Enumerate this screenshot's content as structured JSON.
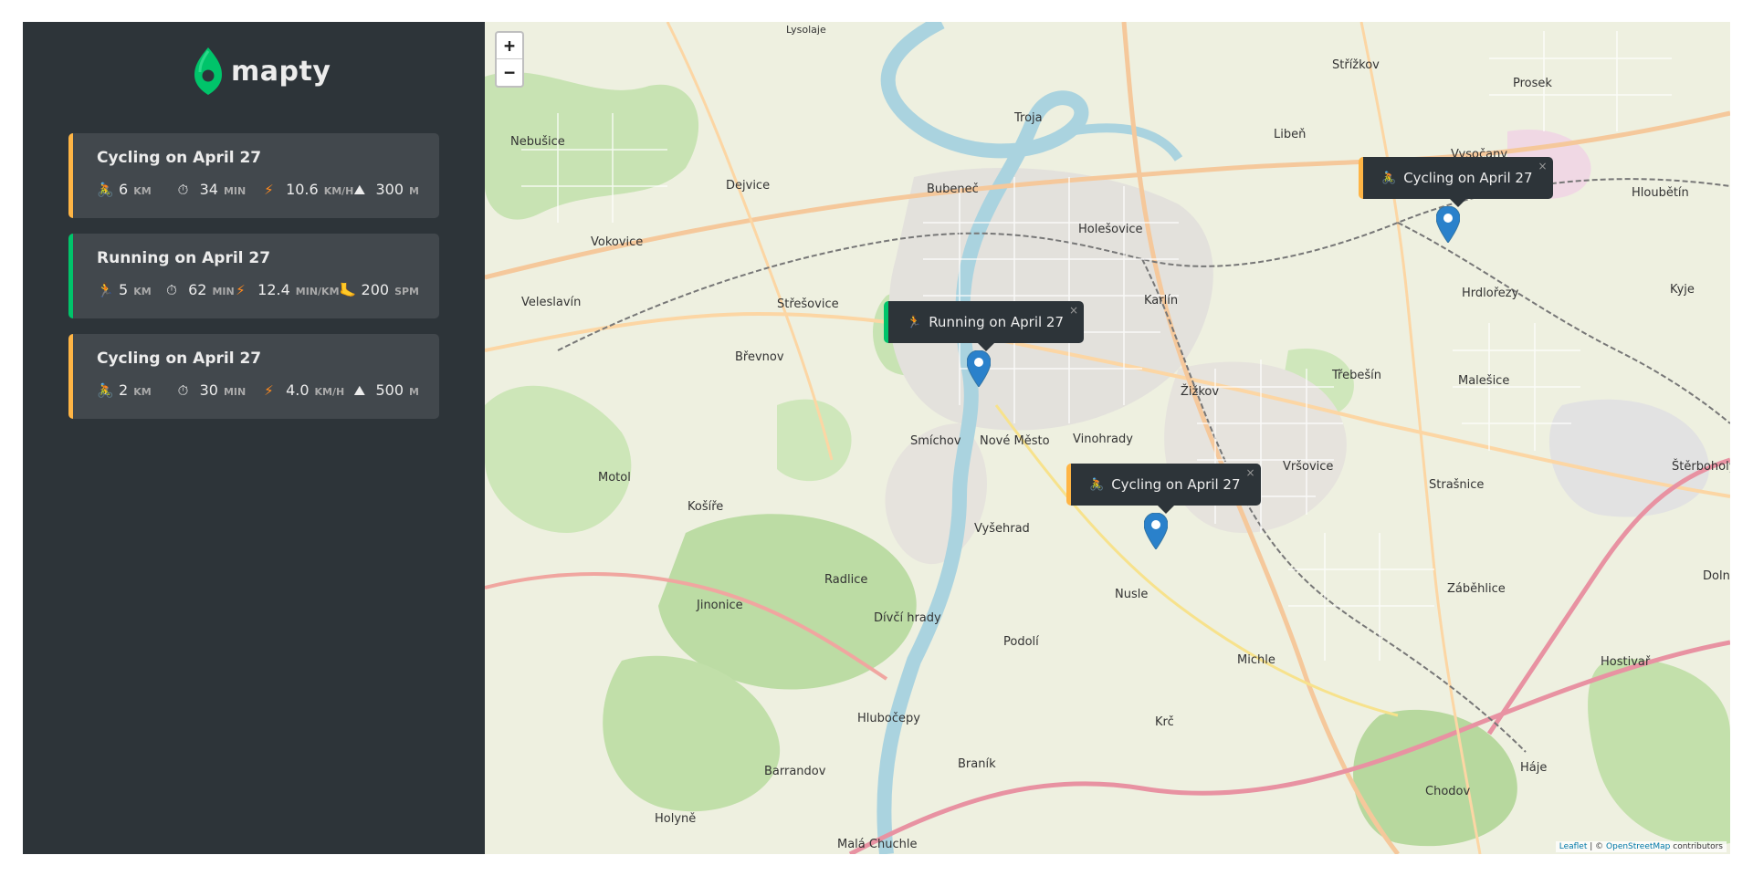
{
  "logo": {
    "text": "mapty",
    "color": "#00c46a"
  },
  "workouts": [
    {
      "type": "cycling",
      "title": "Cycling on April 27",
      "accent": "#ffb545",
      "details": [
        {
          "icon": "cycling-icon",
          "glyph": "🚴",
          "value": "6",
          "unit": "km"
        },
        {
          "icon": "stopwatch-icon",
          "glyph": "⏱",
          "value": "34",
          "unit": "min"
        },
        {
          "icon": "lightning-icon",
          "glyph": "⚡",
          "value": "10.6",
          "unit": "km/h"
        },
        {
          "icon": "mountain-icon",
          "glyph": "⛰",
          "value": "300",
          "unit": "m"
        }
      ]
    },
    {
      "type": "running",
      "title": "Running on April 27",
      "accent": "#00c46a",
      "details": [
        {
          "icon": "running-icon",
          "glyph": "🏃",
          "value": "5",
          "unit": "km"
        },
        {
          "icon": "stopwatch-icon",
          "glyph": "⏱",
          "value": "62",
          "unit": "min"
        },
        {
          "icon": "lightning-icon",
          "glyph": "⚡",
          "value": "12.4",
          "unit": "min/km"
        },
        {
          "icon": "footprint-icon",
          "glyph": "🦶",
          "value": "200",
          "unit": "spm"
        }
      ]
    },
    {
      "type": "cycling",
      "title": "Cycling on April 27",
      "accent": "#ffb545",
      "details": [
        {
          "icon": "cycling-icon",
          "glyph": "🚴",
          "value": "2",
          "unit": "km"
        },
        {
          "icon": "stopwatch-icon",
          "glyph": "⏱",
          "value": "30",
          "unit": "min"
        },
        {
          "icon": "lightning-icon",
          "glyph": "⚡",
          "value": "4.0",
          "unit": "km/h"
        },
        {
          "icon": "mountain-icon",
          "glyph": "⛰",
          "value": "500",
          "unit": "m"
        }
      ]
    }
  ],
  "map": {
    "zoom_in": "+",
    "zoom_out": "−",
    "popups": [
      {
        "type": "cycling",
        "glyph": "🚴",
        "text": "Cycling on April 27",
        "close": "×"
      },
      {
        "type": "running",
        "glyph": "🏃",
        "text": "Running on April 27",
        "close": "×"
      },
      {
        "type": "cycling",
        "glyph": "🚴",
        "text": "Cycling on April 27",
        "close": "×"
      }
    ],
    "attribution": {
      "leaflet": "Leaflet",
      "sep": " | © ",
      "osm": "OpenStreetMap",
      "suffix": " contributors"
    },
    "labels": [
      "Lysolaje",
      "Troja",
      "Libeň",
      "Prosek",
      "Střížkov",
      "Nebušice",
      "Dejvice",
      "Bubeneč",
      "Holešovice",
      "Vysočany",
      "Hloubětín",
      "Vokovice",
      "Veleslavín",
      "Střešovice",
      "Karlín",
      "Hrdlořezy",
      "Kyje",
      "Břevnov",
      "Nové Město",
      "Žižkov",
      "Třebešín",
      "Malešice",
      "Smíchov",
      "Vinohrady",
      "Motol",
      "Košíře",
      "Vršovice",
      "Strašnice",
      "Vyšehrad",
      "Radlice",
      "Jinonice",
      "Nusle",
      "Záběhlice",
      "Dívčí hrady",
      "Podolí",
      "Michle",
      "Hostivař",
      "Hlubočepy",
      "Krč",
      "Barrandov",
      "Braník",
      "Chodov",
      "Háje",
      "Holyně",
      "Malá Chuchle",
      "Štěrboholy",
      "Dolní"
    ]
  }
}
